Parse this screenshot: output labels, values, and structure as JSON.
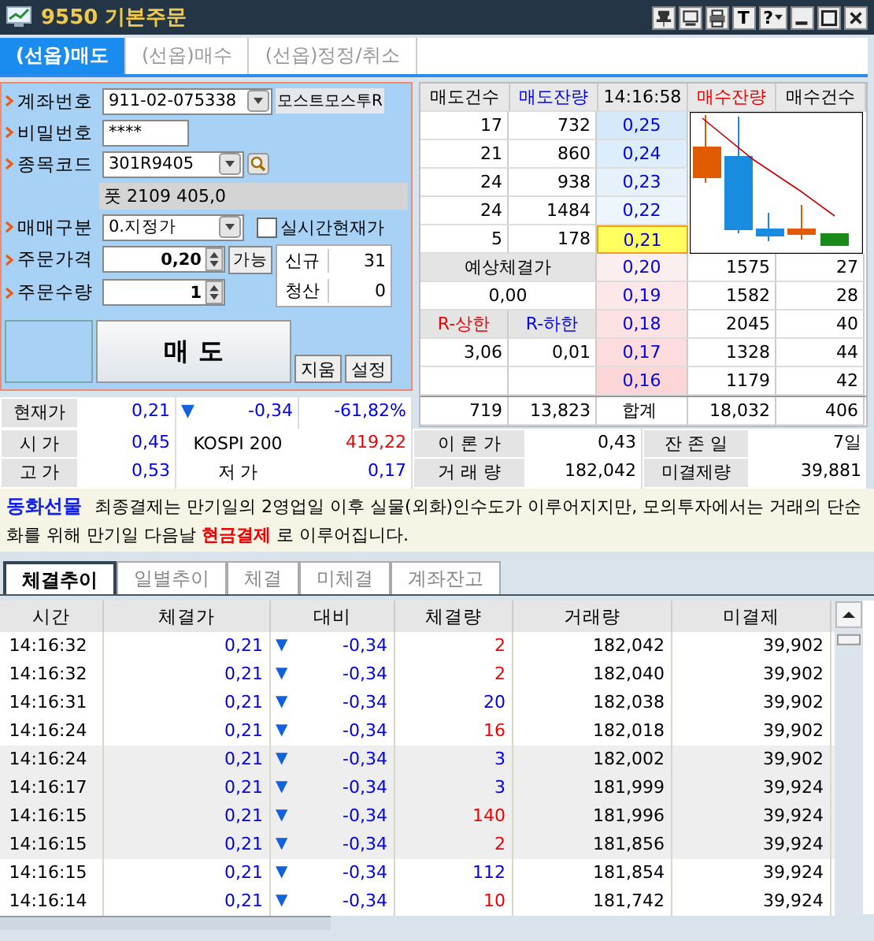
{
  "window": {
    "title": "9550 기본주문"
  },
  "title_buttons": [
    {
      "kind": "pin"
    },
    {
      "kind": "screen"
    },
    {
      "kind": "print"
    },
    {
      "kind": "letter",
      "label": "T"
    },
    {
      "kind": "help",
      "label": "?"
    },
    {
      "kind": "minimize"
    },
    {
      "kind": "maximize"
    },
    {
      "kind": "close"
    }
  ],
  "order_tabs": [
    {
      "label": "(선옵)매도",
      "selected": true
    },
    {
      "label": "(선옵)매수",
      "selected": false
    },
    {
      "label": "(선옵)정정/취소",
      "selected": false
    }
  ],
  "form": {
    "account_label": "계좌번호",
    "account": "911-02-075338",
    "account_name": "모스트모스투R",
    "password_label": "비밀번호",
    "password": "****",
    "code_label": "종목코드",
    "code": "301R9405",
    "product": "풋 2109 405,0",
    "type_label": "매매구분",
    "type": "0.지정가",
    "realtime_label": "실시간현재가",
    "realtime_checked": false,
    "price_label": "주문가격",
    "price": "0,20",
    "able_button": "가능",
    "qty_label": "주문수량",
    "qty": "1",
    "positions": [
      {
        "label": "신규",
        "value": "31"
      },
      {
        "label": "청산",
        "value": "0"
      }
    ],
    "submit_button": "매  도",
    "clear_button": "지움",
    "settings_button": "설정"
  },
  "orderbook": {
    "headers": [
      {
        "label": "매도건수",
        "color": "#000000"
      },
      {
        "label": "매도잔량",
        "color": "#0000f0"
      },
      {
        "label": "14:16:58",
        "color": "#000000"
      },
      {
        "label": "매수잔량",
        "color": "#f00000"
      },
      {
        "label": "매수건수",
        "color": "#000000"
      }
    ],
    "asks": [
      {
        "count": "17",
        "qty": "732",
        "price": "0,25",
        "current": false
      },
      {
        "count": "21",
        "qty": "860",
        "price": "0,24",
        "current": false
      },
      {
        "count": "24",
        "qty": "938",
        "price": "0,23",
        "current": false
      },
      {
        "count": "24",
        "qty": "1484",
        "price": "0,22",
        "current": false
      },
      {
        "count": "5",
        "qty": "178",
        "price": "0,21",
        "current": true
      }
    ],
    "bids": [
      {
        "price": "0,20",
        "qty": "1575",
        "count": "27",
        "current": false
      },
      {
        "price": "0,19",
        "qty": "1582",
        "count": "28",
        "current": false
      },
      {
        "price": "0,18",
        "qty": "2045",
        "count": "40",
        "current": false
      },
      {
        "price": "0,17",
        "qty": "1328",
        "count": "44",
        "current": false
      },
      {
        "price": "0,16",
        "qty": "1179",
        "count": "42",
        "current": false
      }
    ],
    "expected_label": "예상체결가",
    "expected_price": "0,00",
    "upper_label": "R-상한",
    "lower_label": "R-하한",
    "upper_value": "3,06",
    "lower_value": "0,01",
    "total": {
      "ask_count": "719",
      "ask_qty": "13,823",
      "label": "합계",
      "bid_qty": "18,032",
      "bid_count": "406"
    }
  },
  "current": {
    "label": "현재가",
    "price": "0,21",
    "sign": "▼",
    "change": "-0,34",
    "rate": "-61,82%",
    "color": "#0000f0"
  },
  "info_rows": [
    [
      {
        "label": "시 가",
        "value": "0,45",
        "color": "#0000f0"
      },
      {
        "label": "KOSPI 200",
        "value": "419,22",
        "color": "#f00000"
      },
      {
        "label": "이 론 가",
        "value": "0,43",
        "color": "#000000"
      },
      {
        "label": "잔 존 일",
        "value": "7일",
        "color": "#000000"
      }
    ],
    [
      {
        "label": "고 가",
        "value": "0,53",
        "color": "#0000f0"
      },
      {
        "label": "저 가",
        "value": "0,17",
        "color": "#0000f0"
      },
      {
        "label": "거 래 량",
        "value": "182,042",
        "color": "#000000"
      },
      {
        "label": "미결제량",
        "value": "39,881",
        "color": "#000000"
      }
    ]
  ],
  "notice": {
    "title": "동화선물",
    "text": "최종결제는 만기일의 2영업일 이후 실물(외화)인수도가 이루어지지만, 모의투자에서는 거래의 단순화를 위해 만기일 다음날 **현금결제** 로 이루어집니다."
  },
  "bottom_tabs": [
    {
      "label": "체결추이",
      "selected": true
    },
    {
      "label": "일별추이",
      "selected": false
    },
    {
      "label": "체결",
      "selected": false
    },
    {
      "label": "미체결",
      "selected": false
    },
    {
      "label": "계좌잔고",
      "selected": false
    }
  ],
  "trades": {
    "columns": [
      "시간",
      "체결가",
      "대비",
      "체결량",
      "거래량",
      "미결제"
    ],
    "rows": [
      {
        "time": "14:16:32",
        "price": "0,21",
        "sign": "▼",
        "change": "-0,34",
        "qty": "2",
        "volume": "182,042",
        "oi": "39,902",
        "color": "#f00000",
        "shaded": false
      },
      {
        "time": "14:16:32",
        "price": "0,21",
        "sign": "▼",
        "change": "-0,34",
        "qty": "2",
        "volume": "182,040",
        "oi": "39,902",
        "color": "#f00000",
        "shaded": false
      },
      {
        "time": "14:16:31",
        "price": "0,21",
        "sign": "▼",
        "change": "-0,34",
        "qty": "20",
        "volume": "182,038",
        "oi": "39,902",
        "color": "#0000f0",
        "shaded": false
      },
      {
        "time": "14:16:24",
        "price": "0,21",
        "sign": "▼",
        "change": "-0,34",
        "qty": "16",
        "volume": "182,018",
        "oi": "39,902",
        "color": "#f00000",
        "shaded": false
      },
      {
        "time": "14:16:24",
        "price": "0,21",
        "sign": "▼",
        "change": "-0,34",
        "qty": "3",
        "volume": "182,002",
        "oi": "39,902",
        "color": "#0000f0",
        "shaded": true
      },
      {
        "time": "14:16:17",
        "price": "0,21",
        "sign": "▼",
        "change": "-0,34",
        "qty": "3",
        "volume": "181,999",
        "oi": "39,924",
        "color": "#0000f0",
        "shaded": true
      },
      {
        "time": "14:16:15",
        "price": "0,21",
        "sign": "▼",
        "change": "-0,34",
        "qty": "140",
        "volume": "181,996",
        "oi": "39,924",
        "color": "#f00000",
        "shaded": true
      },
      {
        "time": "14:16:15",
        "price": "0,21",
        "sign": "▼",
        "change": "-0,34",
        "qty": "2",
        "volume": "181,856",
        "oi": "39,924",
        "color": "#f00000",
        "shaded": true
      },
      {
        "time": "14:16:15",
        "price": "0,21",
        "sign": "▼",
        "change": "-0,34",
        "qty": "112",
        "volume": "181,854",
        "oi": "39,924",
        "color": "#0000f0",
        "shaded": false
      },
      {
        "time": "14:16:14",
        "price": "0,21",
        "sign": "▼",
        "change": "-0,34",
        "qty": "10",
        "volume": "181,742",
        "oi": "39,924",
        "color": "#f00000",
        "shaded": false
      }
    ]
  }
}
